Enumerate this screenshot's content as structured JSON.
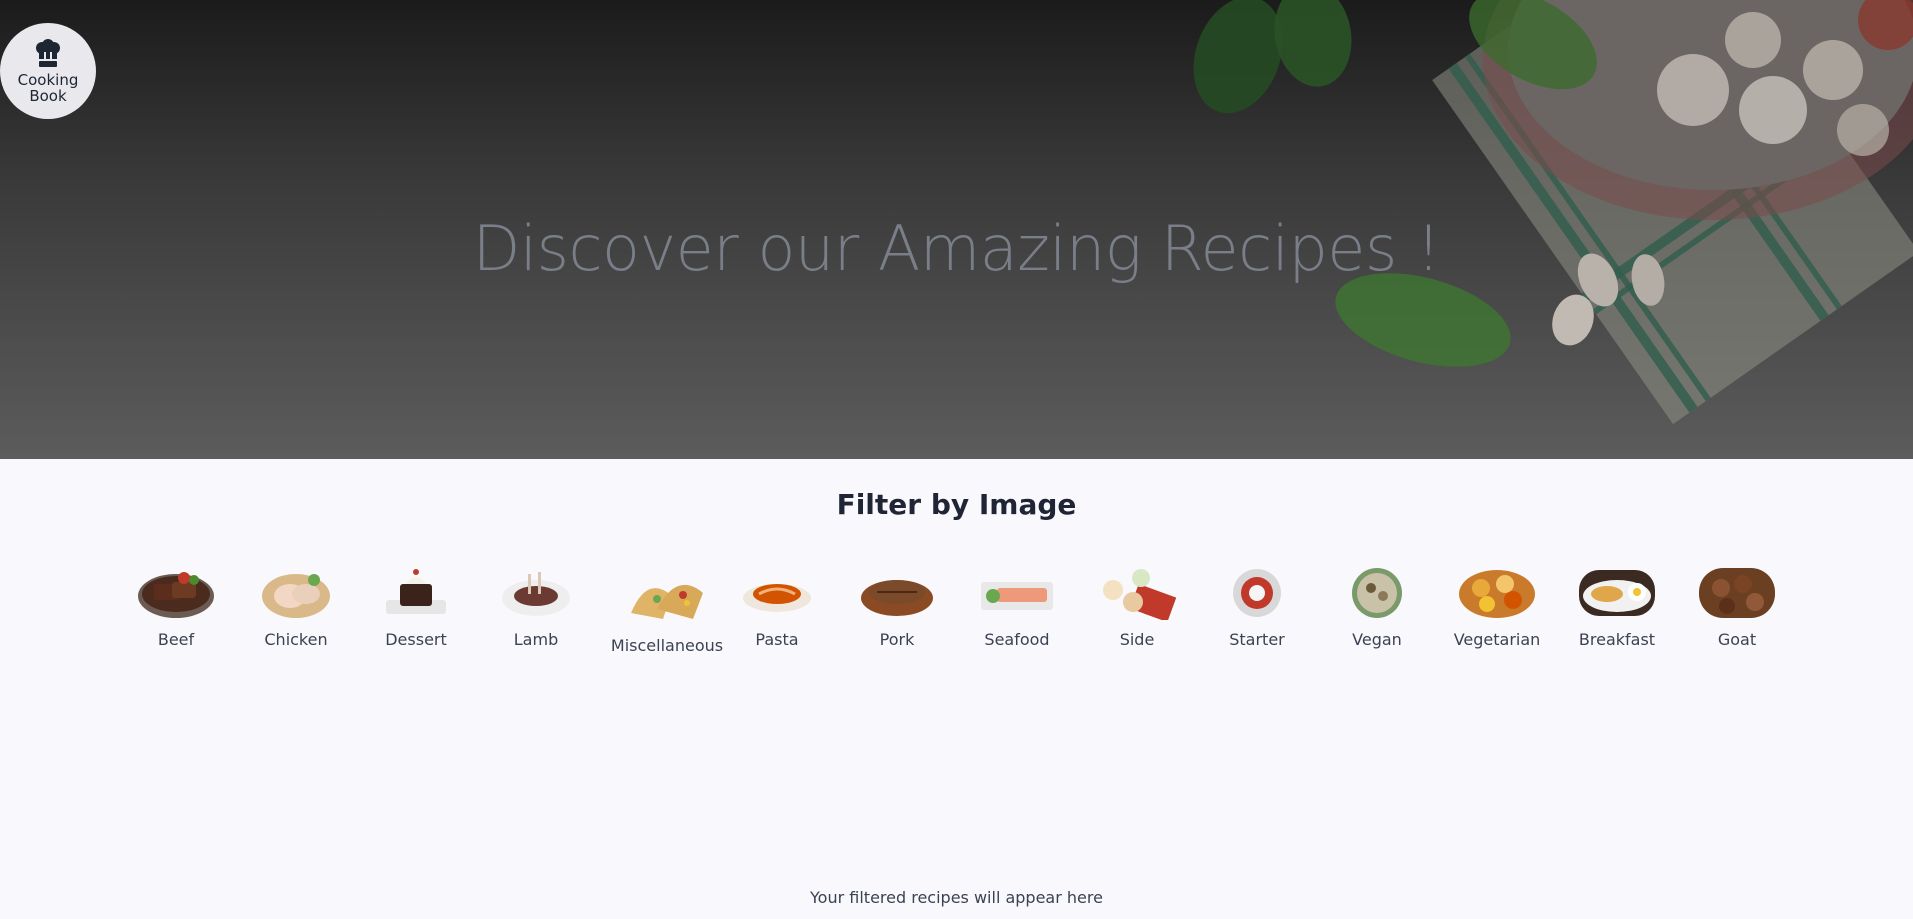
{
  "brand": {
    "line1": "Cooking",
    "line2": "Book",
    "icon": "chef-hat-icon"
  },
  "hero": {
    "title": "Discover our Amazing Recipes !"
  },
  "filter": {
    "title": "Filter by Image",
    "categories": [
      {
        "label": "Beef"
      },
      {
        "label": "Chicken"
      },
      {
        "label": "Dessert"
      },
      {
        "label": "Lamb"
      },
      {
        "label": "Miscellaneous"
      },
      {
        "label": "Pasta"
      },
      {
        "label": "Pork"
      },
      {
        "label": "Seafood"
      },
      {
        "label": "Side"
      },
      {
        "label": "Starter"
      },
      {
        "label": "Vegan"
      },
      {
        "label": "Vegetarian"
      },
      {
        "label": "Breakfast"
      },
      {
        "label": "Goat"
      }
    ]
  },
  "results": {
    "placeholder": "Your filtered recipes will appear here"
  }
}
